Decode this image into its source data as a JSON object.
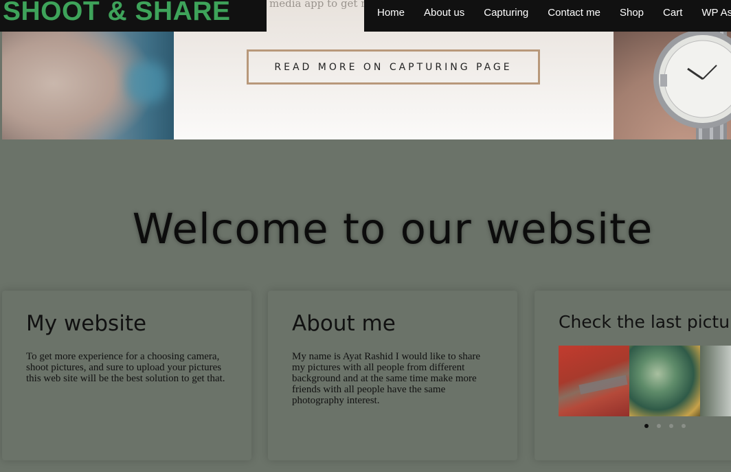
{
  "site": {
    "logo": "SHOOT & SHARE",
    "behind_text": "media app to get more fans and more news Get"
  },
  "nav": {
    "items": [
      "Home",
      "About us",
      "Capturing",
      "Contact me",
      "Shop",
      "Cart",
      "WP Ass"
    ]
  },
  "hero": {
    "button_label": "READ MORE ON CAPTURING PAGE"
  },
  "welcome": {
    "title": "Welcome to our website"
  },
  "cards": {
    "website": {
      "title": "My website",
      "text": "To get more experience for a choosing camera, shoot pictures, and sure to upload your pictures this web site will be the best solution to get that."
    },
    "about": {
      "title": "About me",
      "text": "My name is Ayat Rashid I would like to share my pictures with all people from different background and at the same time make more friends with all people have the same photography interest."
    },
    "gallery": {
      "title": "Check the last pictures"
    }
  },
  "colors": {
    "logo": "#3ea35a",
    "page_bg": "#6b7369",
    "button_border": "#b8987a"
  }
}
